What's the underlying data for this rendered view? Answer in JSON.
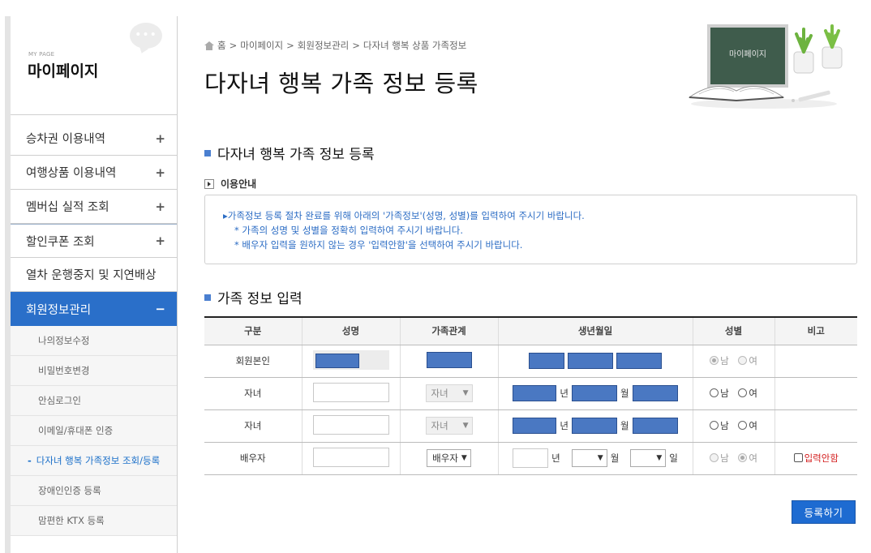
{
  "sidebar": {
    "small_title": "MY PAGE",
    "title": "마이페이지",
    "menu": [
      {
        "label": "승차권 이용내역",
        "sign": "+"
      },
      {
        "label": "여행상품 이용내역",
        "sign": "+"
      },
      {
        "label": "멤버십 실적 조회",
        "sign": "+"
      },
      {
        "label": "할인쿠폰 조회",
        "sign": "+"
      },
      {
        "label": "열차 운행중지 및 지연배상",
        "sign": ""
      },
      {
        "label": "회원정보관리",
        "sign": "−"
      }
    ],
    "submenu": [
      "나의정보수정",
      "비밀번호변경",
      "안심로그인",
      "이메일/휴대폰 인증",
      "다자녀 행복 가족정보 조회/등록",
      "장애인인증 등록",
      "맘편한 KTX 등록"
    ]
  },
  "breadcrumb": {
    "items": [
      "홈",
      "마이페이지",
      "회원정보관리",
      "다자녀 행복 상품 가족정보"
    ],
    "sep": ">"
  },
  "page_title": "다자녀 행복 가족 정보 등록",
  "decor": {
    "board_text": "마이페이지"
  },
  "section1_title": "다자녀 행복 가족 정보 등록",
  "guide": {
    "label": "이용안내",
    "lines": [
      "▸가족정보 등록 절차 완료를 위해 아래의 '가족정보'(성명, 성별)를 입력하여 주시기 바랍니다.",
      "* 가족의 성명 및 성별을 정확히 입력하여 주시기 바랍니다.",
      "* 배우자 입력을 원하지 않는 경우 '입력안함'을 선택하여 주시기 바랍니다."
    ]
  },
  "section2_title": "가족 정보 입력",
  "table": {
    "headers": [
      "구분",
      "성명",
      "가족관계",
      "생년월일",
      "성별",
      "비고"
    ],
    "rows": [
      {
        "type": "회원본인"
      },
      {
        "type": "자녀",
        "relation": "자녀"
      },
      {
        "type": "자녀",
        "relation": "자녀"
      },
      {
        "type": "배우자",
        "relation": "배우자"
      }
    ],
    "units": {
      "year": "년",
      "month": "월",
      "day": "일"
    },
    "gender": {
      "male": "남",
      "female": "여"
    },
    "skip_label": "입력안함"
  },
  "submit_label": "등록하기",
  "colors": {
    "accent": "#2a6fc9",
    "guide_text": "#2b6cc4",
    "warning": "#d42020"
  }
}
